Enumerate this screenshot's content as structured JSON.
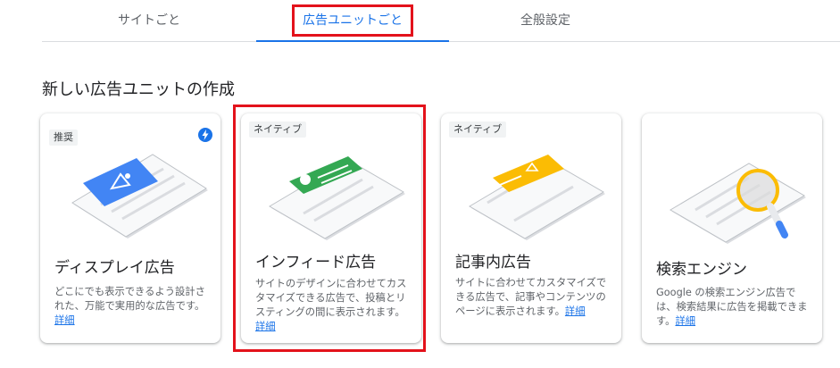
{
  "tabs": [
    {
      "label": "サイトごと",
      "active": false
    },
    {
      "label": "広告ユニットごと",
      "active": true
    },
    {
      "label": "全般設定",
      "active": false
    }
  ],
  "section_title": "新しい広告ユニットの作成",
  "cards": [
    {
      "badge": "推奨",
      "icon": "lightning-bolt-icon",
      "title": "ディスプレイ広告",
      "description": "どこにでも表示できるよう設計された、万能で実用的な広告です。",
      "link": "詳細"
    },
    {
      "badge": "ネイティブ",
      "title": "インフィード広告",
      "description": "サイトのデザインに合わせてカスタマイズできる広告で、投稿とリスティングの間に表示されます。",
      "link": "詳細"
    },
    {
      "badge": "ネイティブ",
      "title": "記事内広告",
      "description": "サイトに合わせてカスタマイズできる広告で、記事やコンテンツのページに表示されます。",
      "link": "詳細"
    },
    {
      "title": "検索エンジン",
      "description": "Google の検索エンジン広告では、検索結果に広告を掲載できます。",
      "link": "詳細"
    }
  ],
  "colors": {
    "accent": "#1a73e8",
    "highlight": "#e3121b",
    "display_ad": "#4285f4",
    "infeed_ad": "#34a853",
    "inarticle_ad": "#fbbc04"
  }
}
